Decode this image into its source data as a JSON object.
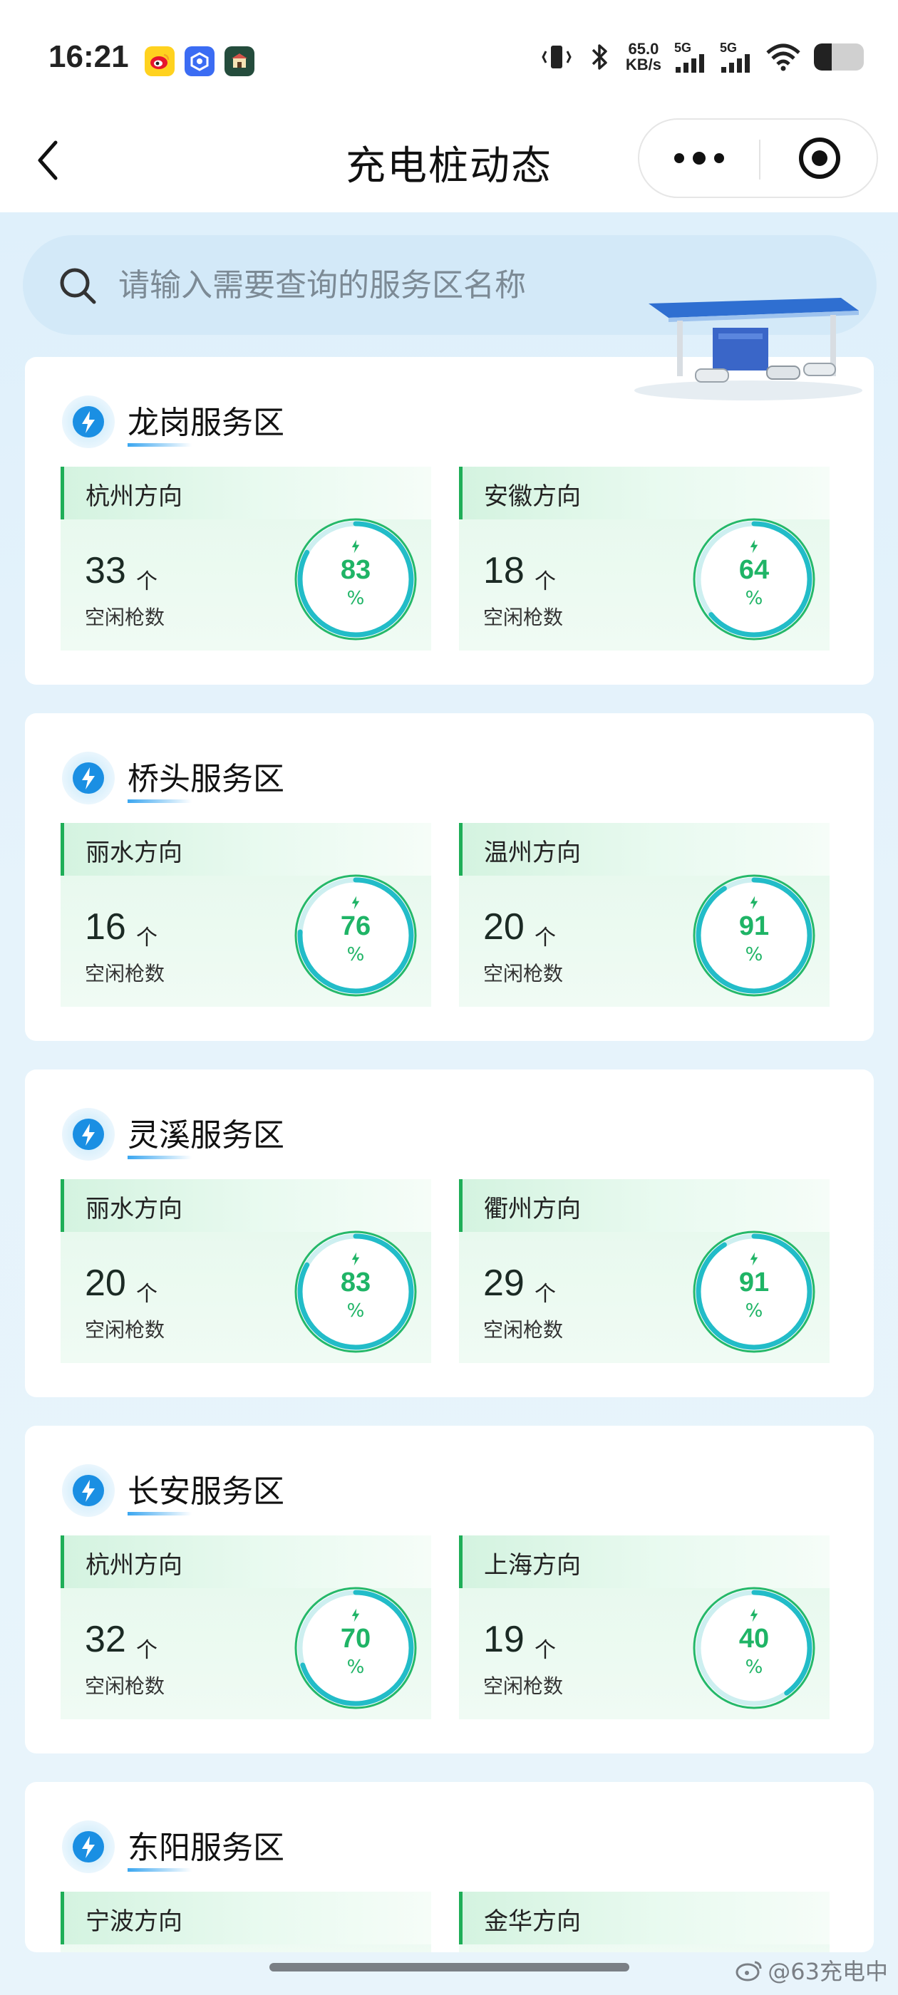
{
  "status_bar": {
    "time": "16:21",
    "net_speed_value": "65.0",
    "net_speed_unit": "KB/s",
    "signal_1_label": "5G",
    "signal_2_label": "5G",
    "battery_level": 0.35
  },
  "header": {
    "title": "充电桩动态"
  },
  "search": {
    "placeholder": "请输入需要查询的服务区名称"
  },
  "labels": {
    "idle_guns": "空闲枪数",
    "unit": "个",
    "percent": "%"
  },
  "service_areas": [
    {
      "name": "龙岗服务区",
      "directions": [
        {
          "name": "杭州方向",
          "idle": "33",
          "percent": 83
        },
        {
          "name": "安徽方向",
          "idle": "18",
          "percent": 64
        }
      ]
    },
    {
      "name": "桥头服务区",
      "directions": [
        {
          "name": "丽水方向",
          "idle": "16",
          "percent": 76
        },
        {
          "name": "温州方向",
          "idle": "20",
          "percent": 91
        }
      ]
    },
    {
      "name": "灵溪服务区",
      "directions": [
        {
          "name": "丽水方向",
          "idle": "20",
          "percent": 83
        },
        {
          "name": "衢州方向",
          "idle": "29",
          "percent": 91
        }
      ]
    },
    {
      "name": "长安服务区",
      "directions": [
        {
          "name": "杭州方向",
          "idle": "32",
          "percent": 70
        },
        {
          "name": "上海方向",
          "idle": "19",
          "percent": 40
        }
      ]
    },
    {
      "name": "东阳服务区",
      "directions": [
        {
          "name": "宁波方向"
        },
        {
          "name": "金华方向"
        }
      ]
    }
  ],
  "watermark": "@63充电中",
  "colors": {
    "accent_green": "#1fb466",
    "ring_teal": "#22bcc8",
    "title_underline_blue": "#3aa6f0",
    "background_blue": "#e3f2fb"
  },
  "icons": {
    "back": "chevron-left-icon",
    "more": "more-dots-icon",
    "close_miniapp": "target-circle-icon",
    "search": "search-icon",
    "service_area": "lightning-bolt-icon"
  }
}
